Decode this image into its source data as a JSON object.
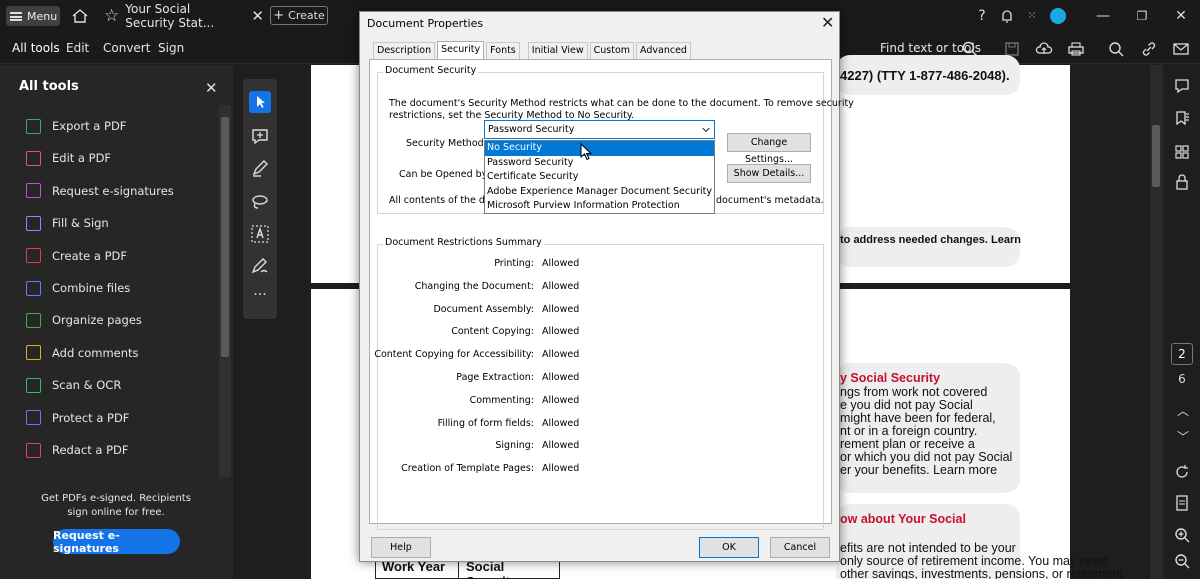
{
  "titlebar": {
    "menu_label": "Menu",
    "tab_title": "Your Social Security Stat...",
    "create_label": "Create"
  },
  "menubar": {
    "items": [
      "All tools",
      "Edit",
      "Convert",
      "Sign"
    ],
    "find_label": "Find text or tools"
  },
  "left_panel": {
    "title": "All tools",
    "items": [
      {
        "label": "Export a PDF",
        "color": "#2fa3a3"
      },
      {
        "label": "Edit a PDF",
        "color": "#e0508f"
      },
      {
        "label": "Request e-signatures",
        "color": "#c050d0"
      },
      {
        "label": "Fill & Sign",
        "color": "#8090ff"
      },
      {
        "label": "Create a PDF",
        "color": "#e04040"
      },
      {
        "label": "Combine files",
        "color": "#6080ff"
      },
      {
        "label": "Organize pages",
        "color": "#40b040"
      },
      {
        "label": "Add comments",
        "color": "#e0b020"
      },
      {
        "label": "Scan & OCR",
        "color": "#30c060"
      },
      {
        "label": "Protect a PDF",
        "color": "#7070ff"
      },
      {
        "label": "Redact a PDF",
        "color": "#e04070"
      }
    ],
    "promo_text": "Get PDFs e-signed. Recipients sign online for free.",
    "promo_button": "Request e-signatures"
  },
  "document": {
    "p1_phone": "4227) (TTY 1-877-486-2048).",
    "p1_bubble2": "to address needed changes.  Learn",
    "p2_heading": "y Social Security",
    "p2_lines": [
      "ngs from work not covered",
      "e you did not pay Social",
      "might have been for federal,",
      "nt or in a foreign country.",
      "rement plan or receive a",
      "or which you did not pay Social",
      "er your benefits. Learn more"
    ],
    "p2_heading2": "ow about Your Social",
    "p2_lines2": [
      "efits are not intended to be your",
      "only source of retirement income. You may need",
      "other savings, investments, pensions, or retirement"
    ],
    "table_headers": [
      "Work Year",
      "Social Security"
    ]
  },
  "right_rail": {
    "page_current": "2",
    "page_total": "6"
  },
  "dialog": {
    "title": "Document Properties",
    "tabs": [
      "Description",
      "Security",
      "Fonts",
      "Initial View",
      "Custom",
      "Advanced"
    ],
    "active_tab": "Security",
    "doc_security_label": "Document Security",
    "intro_text_1": "The document's Security Method restricts what can be done to the document. To remove security",
    "intro_text_2": "restrictions, set the Security Method to No Security.",
    "security_method_label": "Security Method:",
    "security_method_value": "Password Security",
    "change_settings_label": "Change Settings...",
    "can_be_opened_label": "Can be Opened by:",
    "show_details_label": "Show Details...",
    "contents_text_left": "All contents of the docu",
    "contents_text_right": "document's metadata.",
    "dropdown_options": [
      "No Security",
      "Password Security",
      "Certificate Security",
      "Adobe Experience Manager Document Security",
      "Microsoft Purview Information Protection"
    ],
    "dropdown_highlighted": "No Security",
    "restrictions_label": "Document Restrictions Summary",
    "restrictions": [
      {
        "label": "Printing:",
        "value": "Allowed"
      },
      {
        "label": "Changing the Document:",
        "value": "Allowed"
      },
      {
        "label": "Document Assembly:",
        "value": "Allowed"
      },
      {
        "label": "Content Copying:",
        "value": "Allowed"
      },
      {
        "label": "Content Copying for Accessibility:",
        "value": "Allowed"
      },
      {
        "label": "Page Extraction:",
        "value": "Allowed"
      },
      {
        "label": "Commenting:",
        "value": "Allowed"
      },
      {
        "label": "Filling of form fields:",
        "value": "Allowed"
      },
      {
        "label": "Signing:",
        "value": "Allowed"
      },
      {
        "label": "Creation of Template Pages:",
        "value": "Allowed"
      }
    ],
    "help_label": "Help",
    "ok_label": "OK",
    "cancel_label": "Cancel"
  }
}
